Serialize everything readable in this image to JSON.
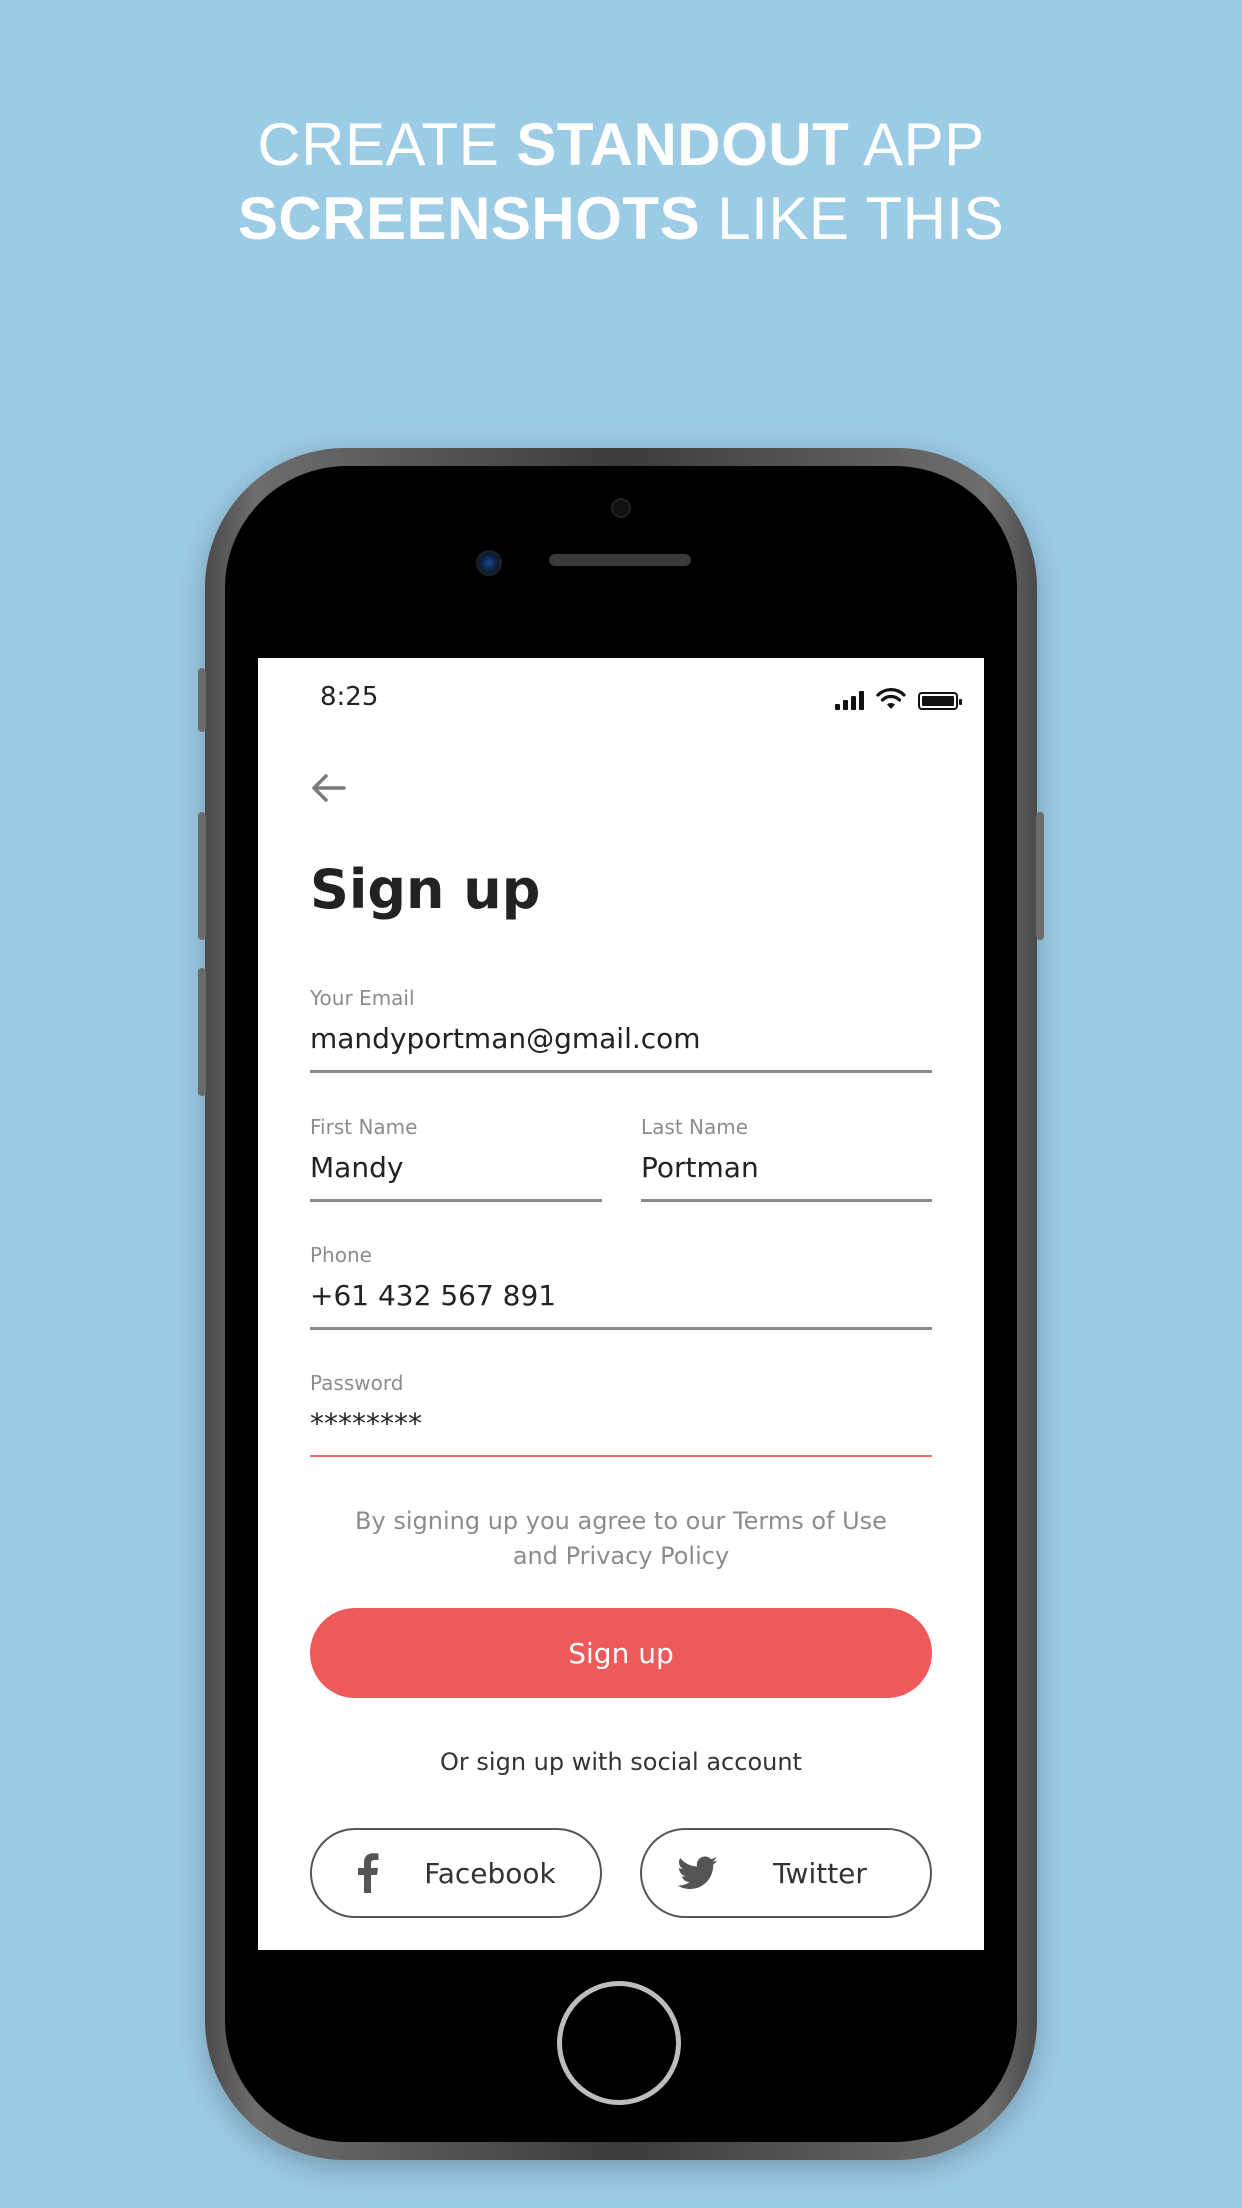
{
  "headline": {
    "line1_a": "CREATE ",
    "line1_b": "STANDOUT",
    "line1_c": " APP",
    "line2_a": "SCREENSHOTS",
    "line2_b": " LIKE THIS"
  },
  "status_bar": {
    "time": "8:25"
  },
  "page": {
    "title": "Sign up"
  },
  "form": {
    "email": {
      "label": "Your Email",
      "value": "mandyportman@gmail.com"
    },
    "first_name": {
      "label": "First Name",
      "value": "Mandy"
    },
    "last_name": {
      "label": "Last Name",
      "value": "Portman"
    },
    "phone": {
      "label": "Phone",
      "value": "+61 432 567 891"
    },
    "password": {
      "label": "Password",
      "value": "********"
    }
  },
  "terms": {
    "line1": "By signing up you agree to our Terms of Use",
    "line2": "and Privacy Policy"
  },
  "signup_button": {
    "label": "Sign up"
  },
  "social": {
    "label": "Or sign up with social account",
    "facebook": "Facebook",
    "twitter": "Twitter"
  },
  "colors": {
    "background": "#9ccbe6",
    "accent": "#ee5a5c",
    "text": "#222222",
    "muted": "#8c8c8c"
  }
}
